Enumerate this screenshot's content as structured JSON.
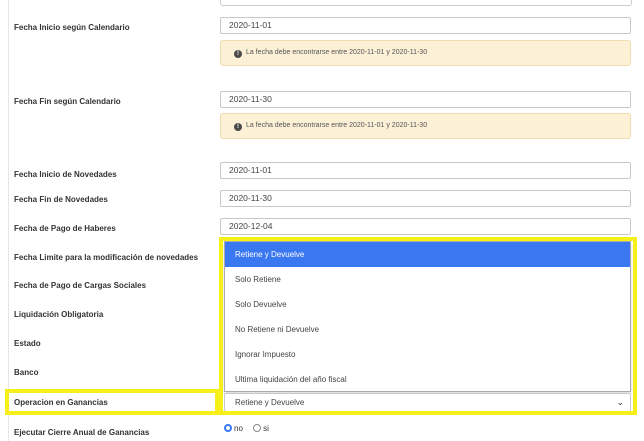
{
  "fields": {
    "fecha_inicio_calendario": {
      "label": "Fecha Inicio según Calendario",
      "value": "2020-11-01"
    },
    "fecha_fin_calendario": {
      "label": "Fecha Fin según Calendario",
      "value": "2020-11-30"
    },
    "fecha_inicio_novedades": {
      "label": "Fecha Inicio de Novedades",
      "value": "2020-11-01"
    },
    "fecha_fin_novedades": {
      "label": "Fecha Fin de Novedades",
      "value": "2020-11-30"
    },
    "fecha_pago_haberes": {
      "label": "Fecha de Pago de Haberes",
      "value": "2020-12-04"
    },
    "fecha_limite_novedades": {
      "label": "Fecha Limite para la modificación de novedades"
    },
    "fecha_pago_cargas": {
      "label": "Fecha de Pago de Cargas Sociales"
    },
    "liquidacion_obligatoria": {
      "label": "Liquidación Obligatoria"
    },
    "estado": {
      "label": "Estado"
    },
    "banco": {
      "label": "Banco"
    },
    "operacion_ganancias": {
      "label": "Operacion en Ganancias",
      "value": "Retiene y Devuelve"
    },
    "cierre_anual": {
      "label": "Ejecutar Cierre Anual de Ganancias"
    }
  },
  "alerts": {
    "inicio": "La fecha debe encontrarse entre 2020-11-01 y 2020-11-30",
    "fin": "La fecha debe encontrarse entre 2020-11-01 y 2020-11-30"
  },
  "dropdown": {
    "options": [
      "Retiene y Devuelve",
      "Solo Retiene",
      "Solo Devuelve",
      "No Retiene ni Devuelve",
      "Ignorar Impuesto",
      "Ultima liquidación del año fiscal"
    ],
    "selected_index": 0
  },
  "radio": {
    "options": [
      "no",
      "si"
    ],
    "selected": "no"
  },
  "colors": {
    "highlight": "#f7ef1a",
    "selected_option": "#3a78f2",
    "alert_bg": "#fcf0d6"
  }
}
